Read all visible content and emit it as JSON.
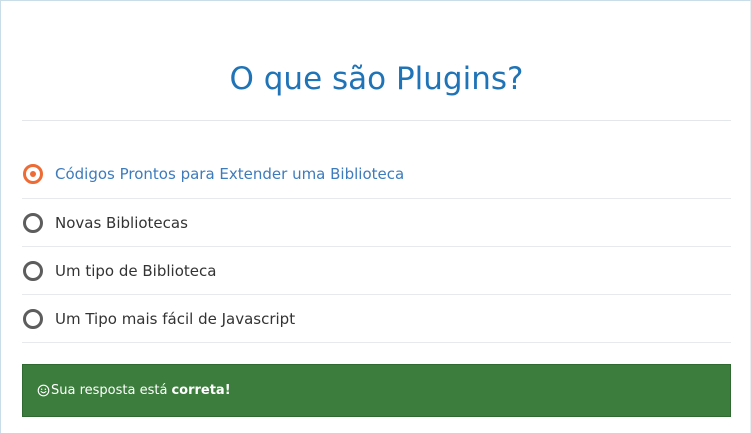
{
  "question": {
    "title": "O que são Plugins?"
  },
  "options": [
    {
      "label": "Códigos Prontos para Extender uma Biblioteca",
      "selected": true
    },
    {
      "label": "Novas Bibliotecas",
      "selected": false
    },
    {
      "label": "Um tipo de Biblioteca",
      "selected": false
    },
    {
      "label": "Um Tipo mais fácil de Javascript",
      "selected": false
    }
  ],
  "feedback": {
    "icon": "smile-icon",
    "message": "Sua resposta está",
    "result": "correta!"
  },
  "colors": {
    "title": "#1f73b7",
    "selected_radio": "#ee6b35",
    "selected_label": "#3d7bbd",
    "feedback_background": "#3c7d3d"
  }
}
